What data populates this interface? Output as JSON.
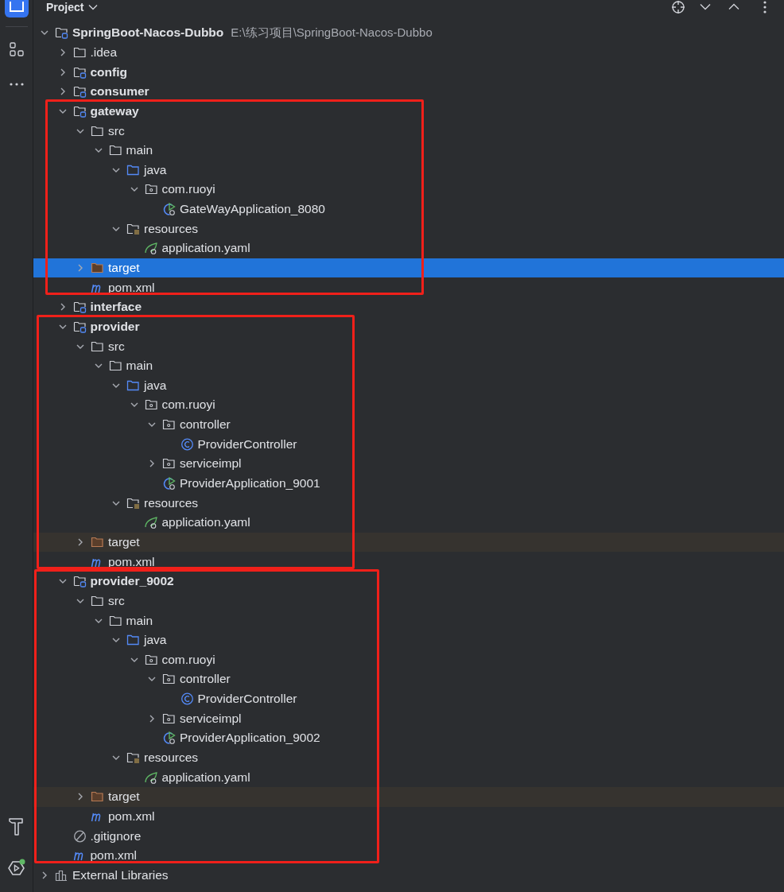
{
  "header": {
    "title": "Project"
  },
  "tree": [
    {
      "kind": "module",
      "label": "SpringBoot-Nacos-Dubbo",
      "path": "E:\\练习项目\\SpringBoot-Nacos-Dubbo",
      "expanded": true,
      "selected": false,
      "children": [
        {
          "kind": "folder",
          "label": ".idea",
          "expanded": false,
          "selected": false
        },
        {
          "kind": "module",
          "label": "config",
          "expanded": false,
          "selected": false
        },
        {
          "kind": "module",
          "label": "consumer",
          "expanded": false,
          "selected": false
        },
        {
          "kind": "module",
          "label": "gateway",
          "expanded": true,
          "selected": false,
          "frame_begin": true,
          "children": [
            {
              "kind": "folder",
              "label": "src",
              "expanded": true,
              "selected": false,
              "children": [
                {
                  "kind": "folder",
                  "label": "main",
                  "expanded": true,
                  "selected": false,
                  "children": [
                    {
                      "kind": "source-root",
                      "label": "java",
                      "expanded": true,
                      "selected": false,
                      "children": [
                        {
                          "kind": "package",
                          "label": "com.ruoyi",
                          "expanded": true,
                          "selected": false,
                          "children": [
                            {
                              "kind": "spring-app",
                              "label": "GateWayApplication_8080",
                              "selected": false
                            }
                          ]
                        }
                      ]
                    },
                    {
                      "kind": "resources",
                      "label": "resources",
                      "expanded": true,
                      "selected": false,
                      "children": [
                        {
                          "kind": "yaml",
                          "label": "application.yaml",
                          "selected": false
                        }
                      ]
                    }
                  ]
                }
              ]
            },
            {
              "kind": "excluded",
              "label": "target",
              "expanded": false,
              "selected": true
            },
            {
              "kind": "maven",
              "label": "pom.xml",
              "selected": false,
              "frame_end": true
            }
          ]
        },
        {
          "kind": "module",
          "label": "interface",
          "expanded": false,
          "selected": false
        },
        {
          "kind": "module",
          "label": "provider",
          "expanded": true,
          "selected": false,
          "frame_begin": true,
          "children": [
            {
              "kind": "folder",
              "label": "src",
              "expanded": true,
              "selected": false,
              "children": [
                {
                  "kind": "folder",
                  "label": "main",
                  "expanded": true,
                  "selected": false,
                  "children": [
                    {
                      "kind": "source-root",
                      "label": "java",
                      "expanded": true,
                      "selected": false,
                      "children": [
                        {
                          "kind": "package",
                          "label": "com.ruoyi",
                          "expanded": true,
                          "selected": false,
                          "children": [
                            {
                              "kind": "package",
                              "label": "controller",
                              "expanded": true,
                              "selected": false,
                              "children": [
                                {
                                  "kind": "class",
                                  "label": "ProviderController",
                                  "selected": false
                                }
                              ]
                            },
                            {
                              "kind": "package",
                              "label": "serviceimpl",
                              "expanded": false,
                              "selected": false
                            },
                            {
                              "kind": "spring-app",
                              "label": "ProviderApplication_9001",
                              "selected": false
                            }
                          ]
                        }
                      ]
                    },
                    {
                      "kind": "resources",
                      "label": "resources",
                      "expanded": true,
                      "selected": false,
                      "children": [
                        {
                          "kind": "yaml",
                          "label": "application.yaml",
                          "selected": false
                        }
                      ]
                    }
                  ]
                }
              ]
            },
            {
              "kind": "excluded",
              "label": "target",
              "expanded": false,
              "selected": false,
              "highlighted": true
            },
            {
              "kind": "maven",
              "label": "pom.xml",
              "selected": false,
              "frame_end": true
            }
          ]
        },
        {
          "kind": "module",
          "label": "provider_9002",
          "expanded": true,
          "selected": false,
          "frame_begin": true,
          "children": [
            {
              "kind": "folder",
              "label": "src",
              "expanded": true,
              "selected": false,
              "children": [
                {
                  "kind": "folder",
                  "label": "main",
                  "expanded": true,
                  "selected": false,
                  "children": [
                    {
                      "kind": "source-root",
                      "label": "java",
                      "expanded": true,
                      "selected": false,
                      "children": [
                        {
                          "kind": "package",
                          "label": "com.ruoyi",
                          "expanded": true,
                          "selected": false,
                          "children": [
                            {
                              "kind": "package",
                              "label": "controller",
                              "expanded": true,
                              "selected": false,
                              "children": [
                                {
                                  "kind": "class",
                                  "label": "ProviderController",
                                  "selected": false
                                }
                              ]
                            },
                            {
                              "kind": "package",
                              "label": "serviceimpl",
                              "expanded": false,
                              "selected": false
                            },
                            {
                              "kind": "spring-app",
                              "label": "ProviderApplication_9002",
                              "selected": false
                            }
                          ]
                        }
                      ]
                    },
                    {
                      "kind": "resources",
                      "label": "resources",
                      "expanded": true,
                      "selected": false,
                      "children": [
                        {
                          "kind": "yaml",
                          "label": "application.yaml",
                          "selected": false
                        }
                      ]
                    }
                  ]
                }
              ]
            },
            {
              "kind": "excluded",
              "label": "target",
              "expanded": false,
              "selected": false,
              "highlighted": true
            },
            {
              "kind": "maven",
              "label": "pom.xml",
              "selected": false
            }
          ]
        },
        {
          "kind": "gitignore",
          "label": ".gitignore",
          "selected": false
        },
        {
          "kind": "maven",
          "label": "pom.xml",
          "selected": false,
          "frame_end": true
        }
      ]
    },
    {
      "kind": "libraries",
      "label": "External Libraries",
      "expanded": false,
      "selected": false
    }
  ]
}
